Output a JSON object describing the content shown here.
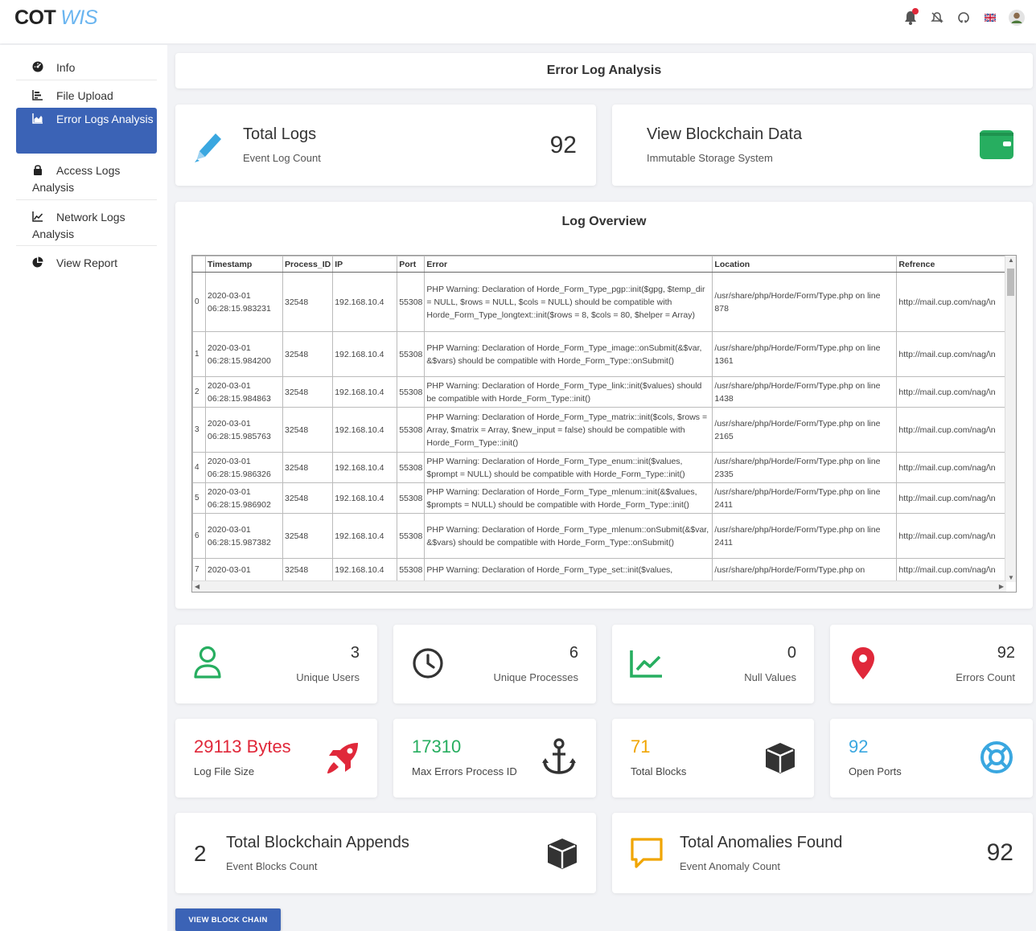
{
  "brand": {
    "part1": "COT",
    "part2": "WIS"
  },
  "top_icons": [
    "notifications-icon",
    "bell-off-icon",
    "github-icon",
    "flag-icon",
    "user-avatar"
  ],
  "sidebar": {
    "items": [
      {
        "label": "Info",
        "icon": "dashboard-icon"
      },
      {
        "label": "File Upload",
        "icon": "bar-chart-icon"
      },
      {
        "label": "Error Logs Analysis",
        "icon": "area-chart-icon",
        "active": true
      },
      {
        "label": "Access Logs Analysis",
        "icon": "lock-icon"
      },
      {
        "label": "Network Logs Analysis",
        "icon": "line-chart-icon"
      },
      {
        "label": "View Report",
        "icon": "pie-chart-icon"
      }
    ]
  },
  "header": {
    "title": "Error Log Analysis"
  },
  "total_logs": {
    "title": "Total Logs",
    "subtitle": "Event Log Count",
    "value": "92"
  },
  "blockchain_card": {
    "title": "View Blockchain Data",
    "subtitle": "Immutable Storage System"
  },
  "log_overview": {
    "title": "Log Overview",
    "columns": [
      "",
      "Timestamp",
      "Process_ID",
      "IP",
      "Port",
      "Error",
      "Location",
      "Refrence"
    ],
    "rows": [
      {
        "idx": "0",
        "ts": "2020-03-01 06:28:15.983231",
        "pid": "32548",
        "ip": "192.168.10.4",
        "port": "55308",
        "error": "PHP Warning: Declaration of Horde_Form_Type_pgp::init($gpg, $temp_dir = NULL, $rows = NULL, $cols = NULL) should be compatible with Horde_Form_Type_longtext::init($rows = 8, $cols = 80, $helper = Array)",
        "loc": "/usr/share/php/Horde/Form/Type.php on line 878",
        "ref": "http://mail.cup.com/nag/\\n"
      },
      {
        "idx": "1",
        "ts": "2020-03-01 06:28:15.984200",
        "pid": "32548",
        "ip": "192.168.10.4",
        "port": "55308",
        "error": "PHP Warning: Declaration of Horde_Form_Type_image::onSubmit(&$var, &$vars) should be compatible with Horde_Form_Type::onSubmit()",
        "loc": "/usr/share/php/Horde/Form/Type.php on line 1361",
        "ref": "http://mail.cup.com/nag/\\n"
      },
      {
        "idx": "2",
        "ts": "2020-03-01 06:28:15.984863",
        "pid": "32548",
        "ip": "192.168.10.4",
        "port": "55308",
        "error": "PHP Warning: Declaration of Horde_Form_Type_link::init($values) should be compatible with Horde_Form_Type::init()",
        "loc": "/usr/share/php/Horde/Form/Type.php on line 1438",
        "ref": "http://mail.cup.com/nag/\\n"
      },
      {
        "idx": "3",
        "ts": "2020-03-01 06:28:15.985763",
        "pid": "32548",
        "ip": "192.168.10.4",
        "port": "55308",
        "error": "PHP Warning: Declaration of Horde_Form_Type_matrix::init($cols, $rows = Array, $matrix = Array, $new_input = false) should be compatible with Horde_Form_Type::init()",
        "loc": "/usr/share/php/Horde/Form/Type.php on line 2165",
        "ref": "http://mail.cup.com/nag/\\n"
      },
      {
        "idx": "4",
        "ts": "2020-03-01 06:28:15.986326",
        "pid": "32548",
        "ip": "192.168.10.4",
        "port": "55308",
        "error": "PHP Warning: Declaration of Horde_Form_Type_enum::init($values, $prompt = NULL) should be compatible with Horde_Form_Type::init()",
        "loc": "/usr/share/php/Horde/Form/Type.php on line 2335",
        "ref": "http://mail.cup.com/nag/\\n"
      },
      {
        "idx": "5",
        "ts": "2020-03-01 06:28:15.986902",
        "pid": "32548",
        "ip": "192.168.10.4",
        "port": "55308",
        "error": "PHP Warning: Declaration of Horde_Form_Type_mlenum::init(&$values, $prompts = NULL) should be compatible with Horde_Form_Type::init()",
        "loc": "/usr/share/php/Horde/Form/Type.php on line 2411",
        "ref": "http://mail.cup.com/nag/\\n"
      },
      {
        "idx": "6",
        "ts": "2020-03-01 06:28:15.987382",
        "pid": "32548",
        "ip": "192.168.10.4",
        "port": "55308",
        "error": "PHP Warning: Declaration of Horde_Form_Type_mlenum::onSubmit(&$var, &$vars) should be compatible with Horde_Form_Type::onSubmit()",
        "loc": "/usr/share/php/Horde/Form/Type.php on line 2411",
        "ref": "http://mail.cup.com/nag/\\n"
      },
      {
        "idx": "7",
        "ts": "2020-03-01",
        "pid": "32548",
        "ip": "192.168.10.4",
        "port": "55308",
        "error": "PHP Warning: Declaration of Horde_Form_Type_set::init($values,",
        "loc": "/usr/share/php/Horde/Form/Type.php on",
        "ref": "http://mail.cup.com/nag/\\n"
      }
    ]
  },
  "stats": [
    {
      "value": "3",
      "label": "Unique Users",
      "icon": "user-icon",
      "color": "#27ae60"
    },
    {
      "value": "6",
      "label": "Unique Processes",
      "icon": "clock-icon",
      "color": "#333333"
    },
    {
      "value": "0",
      "label": "Null Values",
      "icon": "line-chart-icon",
      "color": "#27ae60"
    },
    {
      "value": "92",
      "label": "Errors Count",
      "icon": "map-pin-icon",
      "color": "#e0283a"
    }
  ],
  "metrics": [
    {
      "value": "29113 Bytes",
      "label": "Log File Size",
      "icon": "rocket-icon",
      "color": "#e0283a"
    },
    {
      "value": "17310",
      "label": "Max Errors Process ID",
      "icon": "anchor-icon",
      "color": "#27ae60"
    },
    {
      "value": "71",
      "label": "Total Blocks",
      "icon": "cube-icon",
      "color": "#f0a500"
    },
    {
      "value": "92",
      "label": "Open Ports",
      "icon": "lifebuoy-icon",
      "color": "#3aa7e0"
    }
  ],
  "appends": {
    "value": "2",
    "title": "Total Blockchain Appends",
    "subtitle": "Event Blocks Count"
  },
  "anomalies": {
    "value": "92",
    "title": "Total Anomalies Found",
    "subtitle": "Event Anomaly Count"
  },
  "button": {
    "label": "VIEW BLOCK CHAIN"
  }
}
